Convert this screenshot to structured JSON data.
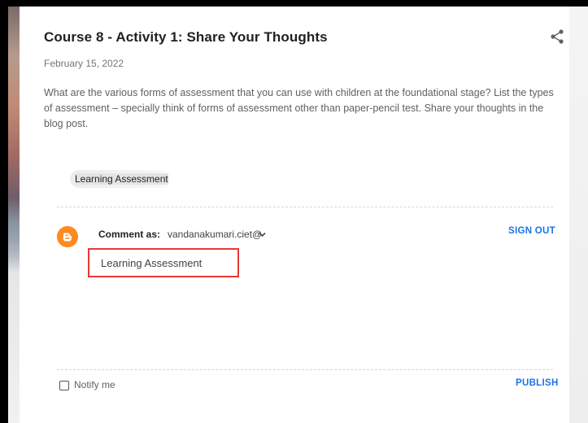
{
  "post": {
    "title": "Course 8 - Activity 1: Share Your Thoughts",
    "date": "February 15, 2022",
    "body": "What are the various forms of assessment that you can use with children at the foundational stage? List the types of assessment – specially think of forms of assessment other than paper-pencil test. Share your thoughts in the blog post.",
    "label": "Learning Assessment"
  },
  "comment": {
    "comment_as_label": "Comment as:",
    "account": "vandanakumari.ciet@",
    "sign_out": "SIGN OUT",
    "input_value": "Learning Assessment",
    "notify_label": "Notify me",
    "notify_checked": false,
    "publish": "PUBLISH"
  },
  "colors": {
    "title": "#212121",
    "link": "#1a73e8",
    "blogger_orange": "#ff8a1e",
    "highlight_border": "#e53935"
  },
  "icons": {
    "share": "share-icon",
    "blogger": "blogger-icon",
    "dropdown": "chevron-down-icon"
  }
}
